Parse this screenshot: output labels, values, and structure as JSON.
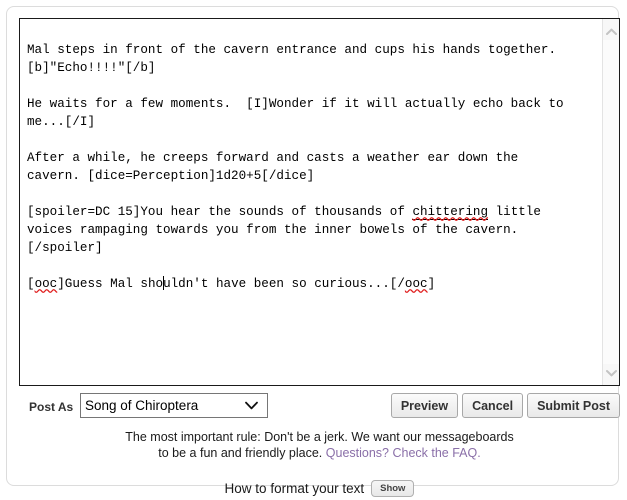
{
  "editor": {
    "name": "post-body-textarea",
    "content_lines": [
      "Mal steps in front of the cavern entrance and cups his hands together. [b]\"Echo!!!!\"[/b]",
      "",
      "He waits for a few moments.  [I]Wonder if it will actually echo back to me...[/I]",
      "",
      "After a while, he creeps forward and casts a weather ear down the cavern. [dice=Perception]1d20+5[/dice]",
      "",
      "[spoiler=DC 15]You hear the sounds of thousands of chittering little voices rampaging towards you from the inner bowels of the cavern.[/spoiler]",
      "",
      "[ooc]Guess Mal shouldn't have been so curious...[/ooc]"
    ],
    "segments": {
      "p1_a": "Mal steps in front of the cavern entrance and cups his hands together.\n[b]\"Echo!!!!\"[/b]",
      "p2_a": "He waits for a few moments.  [I]Wonder if it will actually echo back to\nme...[/I]",
      "p3_a": "After a while, he creeps forward and casts a weather ear down the\ncavern. [dice=Perception]1d20+5[/dice]",
      "p4_a": "[spoiler=DC 15]You hear the sounds of thousands of ",
      "p4_misspelled": "chittering",
      "p4_b": " little\nvoices rampaging towards you from the inner bowels of the cavern.\n[/spoiler]",
      "p5_open_bracket": "[",
      "p5_ooc_open": "ooc",
      "p5_a": "]Guess Mal sho",
      "p5_b": "uldn't have been so curious...[/",
      "p5_ooc_close": "ooc",
      "p5_close_bracket": "]"
    }
  },
  "scrollbar": {
    "up_icon": "chevron-up-icon",
    "down_icon": "chevron-down-icon"
  },
  "controls": {
    "post_as_label": "Post As",
    "account_select": {
      "selected": "Song of Chiroptera",
      "options": [
        "Song of Chiroptera"
      ],
      "chevron_icon": "chevron-down-icon"
    },
    "buttons": [
      {
        "id": "preview",
        "label": "Preview"
      },
      {
        "id": "cancel",
        "label": "Cancel"
      },
      {
        "id": "submit",
        "label": "Submit Post"
      }
    ]
  },
  "footer": {
    "rules_line1": "The most important rule: Don't be a jerk. We want our messageboards",
    "rules_line2_prefix": "to be a fun and friendly place. ",
    "faq_link": "Questions? Check the FAQ.",
    "format_label": "How to format your text",
    "show_button": "Show"
  },
  "colors": {
    "link": "#8a6fa8",
    "spellcheck_underline": "#e02020",
    "panel_border": "#dcdcdc",
    "textarea_border": "#1a1a1a"
  }
}
